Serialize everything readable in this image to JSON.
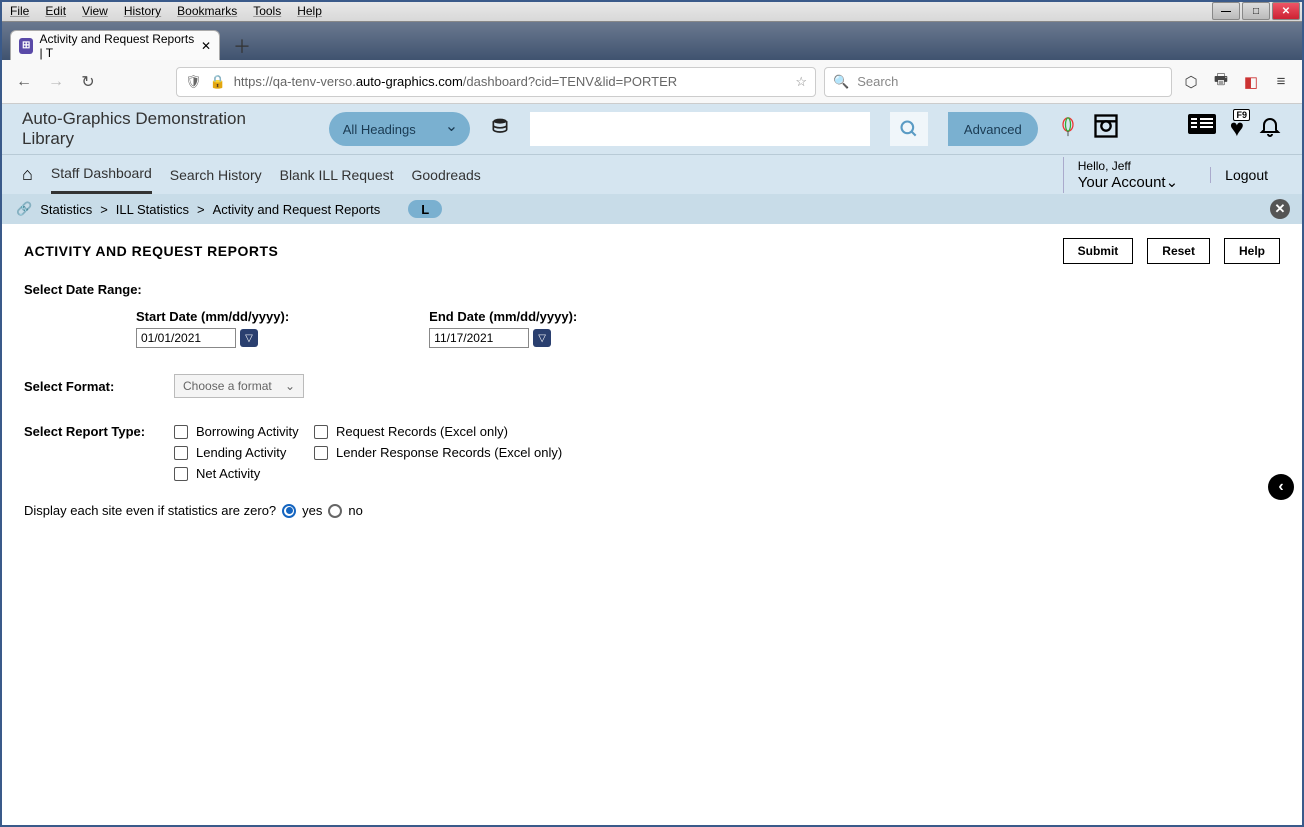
{
  "browser": {
    "menus": [
      "File",
      "Edit",
      "View",
      "History",
      "Bookmarks",
      "Tools",
      "Help"
    ],
    "tab_title": "Activity and Request Reports | T",
    "url_prefix": "https://qa-tenv-verso.",
    "url_domain": "auto-graphics.com",
    "url_path": "/dashboard?cid=TENV&lid=PORTER",
    "search_placeholder": "Search"
  },
  "app_header": {
    "library_name": "Auto-Graphics Demonstration Library",
    "heading_filter": "All Headings",
    "advanced_label": "Advanced",
    "fav_badge": "F9"
  },
  "nav": {
    "items": [
      "Staff Dashboard",
      "Search History",
      "Blank ILL Request",
      "Goodreads"
    ],
    "hello": "Hello, Jeff",
    "account": "Your Account",
    "logout": "Logout"
  },
  "breadcrumb": {
    "items": [
      "Statistics",
      "ILL Statistics",
      "Activity and Request Reports"
    ],
    "pill": "L"
  },
  "report": {
    "title": "ACTIVITY AND REQUEST REPORTS",
    "submit": "Submit",
    "reset": "Reset",
    "help": "Help",
    "date_range_label": "Select Date Range:",
    "start_label": "Start Date (mm/dd/yyyy):",
    "start_value": "01/01/2021",
    "end_label": "End Date (mm/dd/yyyy):",
    "end_value": "11/17/2021",
    "format_label": "Select Format:",
    "format_placeholder": "Choose a format",
    "type_label": "Select Report Type:",
    "types": {
      "borrowing": "Borrowing Activity",
      "lending": "Lending Activity",
      "net": "Net Activity",
      "request_records": "Request Records (Excel only)",
      "lender_response": "Lender Response Records (Excel only)"
    },
    "zero_question": "Display each site even if statistics are zero?",
    "yes": "yes",
    "no": "no"
  }
}
